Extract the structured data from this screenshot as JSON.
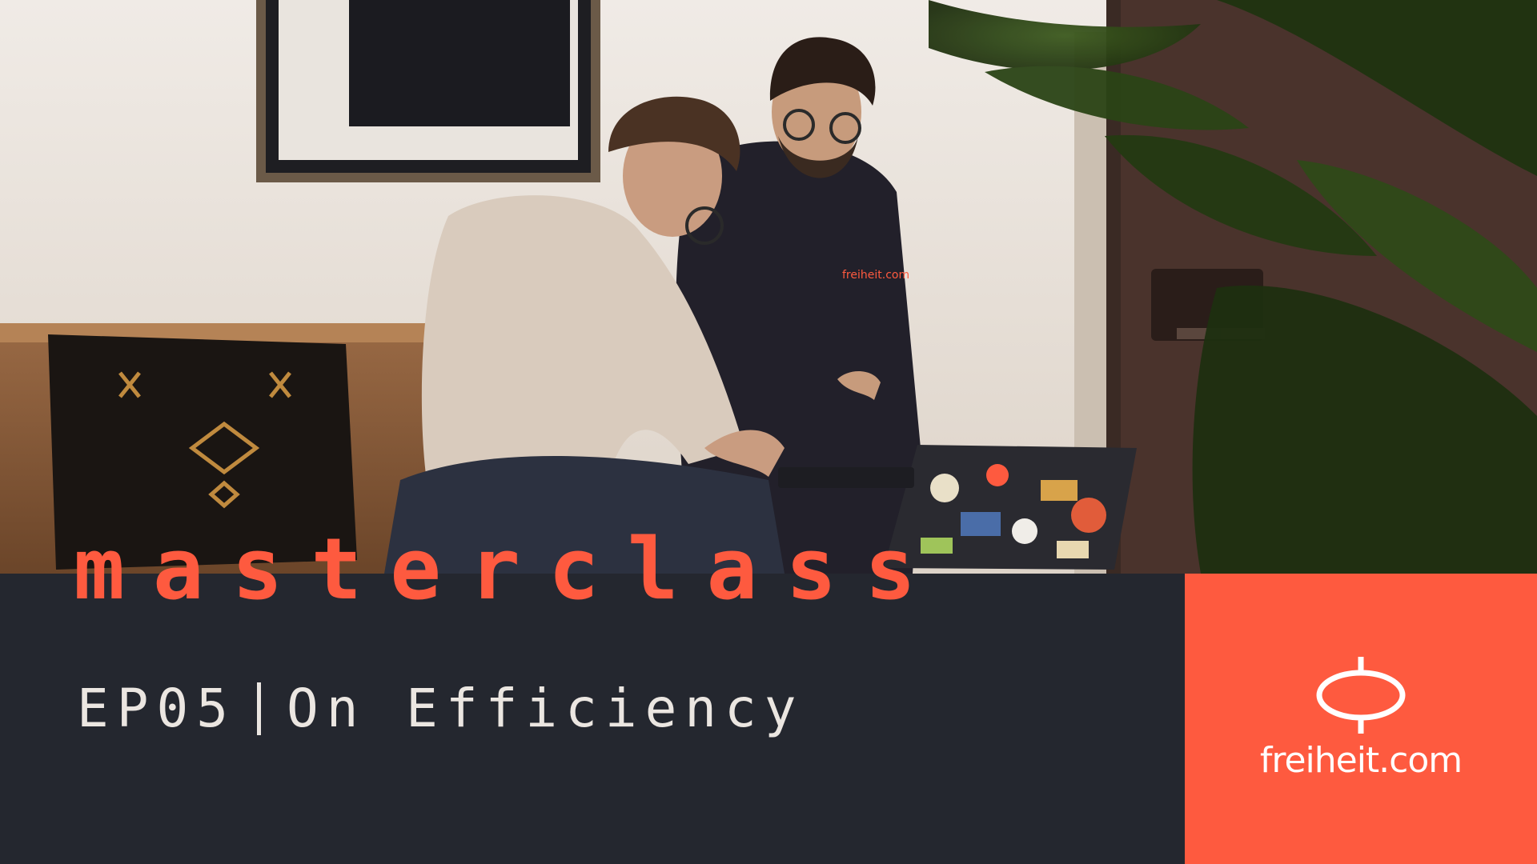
{
  "hero": {
    "series_title": "masterclass",
    "episode": "EP05",
    "episode_title": "On Efficiency",
    "hoodie_print": "freiheit.com"
  },
  "brand": {
    "name": "freiheit.com",
    "logo_icon": "freiheit-logo-icon"
  },
  "colors": {
    "accent": "#fe5a3f",
    "dark": "#24272f",
    "light_text": "#ebe6e1"
  }
}
